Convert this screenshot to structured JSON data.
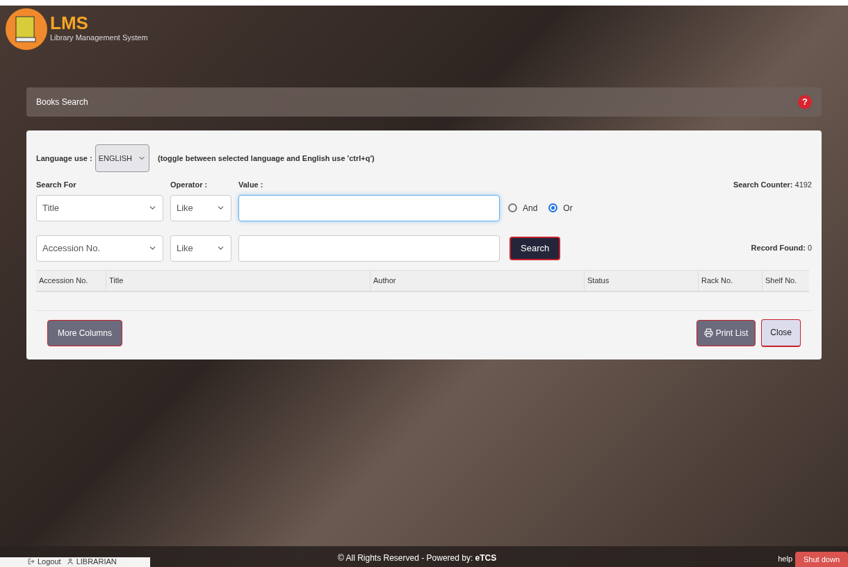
{
  "logo": {
    "title": "LMS",
    "subtitle": "Library Management System"
  },
  "panel_header": {
    "title": "Books Search",
    "help": "?"
  },
  "language": {
    "label": "Language use :",
    "value": "ENGLISH",
    "hint": "(toggle between selected language and English use 'ctrl+q')"
  },
  "labels": {
    "search_for": "Search For",
    "operator": "Operator :",
    "value": "Value :"
  },
  "search_counter": {
    "label": "Search Counter:",
    "value": "4192"
  },
  "record_found": {
    "label": "Record Found:",
    "value": "0"
  },
  "rows": [
    {
      "field": "Title",
      "operator": "Like",
      "value": "",
      "focused": true
    },
    {
      "field": "Accession No.",
      "operator": "Like",
      "value": "",
      "focused": false
    }
  ],
  "logic": [
    {
      "label": "And",
      "selected": false
    },
    {
      "label": "Or",
      "selected": true
    }
  ],
  "search_button": "Search",
  "table": {
    "columns": [
      "Accession No.",
      "Title",
      "Author",
      "Status",
      "Rack No.",
      "Shelf No."
    ]
  },
  "buttons": {
    "more_columns": "More Columns",
    "print_list": "Print List",
    "close": "Close"
  },
  "footer": {
    "logout": "Logout",
    "user": "LIBRARIAN",
    "copyright": "© All Rights Reserved - Powered by: **eTCS**",
    "help": "help",
    "shutdown": "Shut down"
  }
}
